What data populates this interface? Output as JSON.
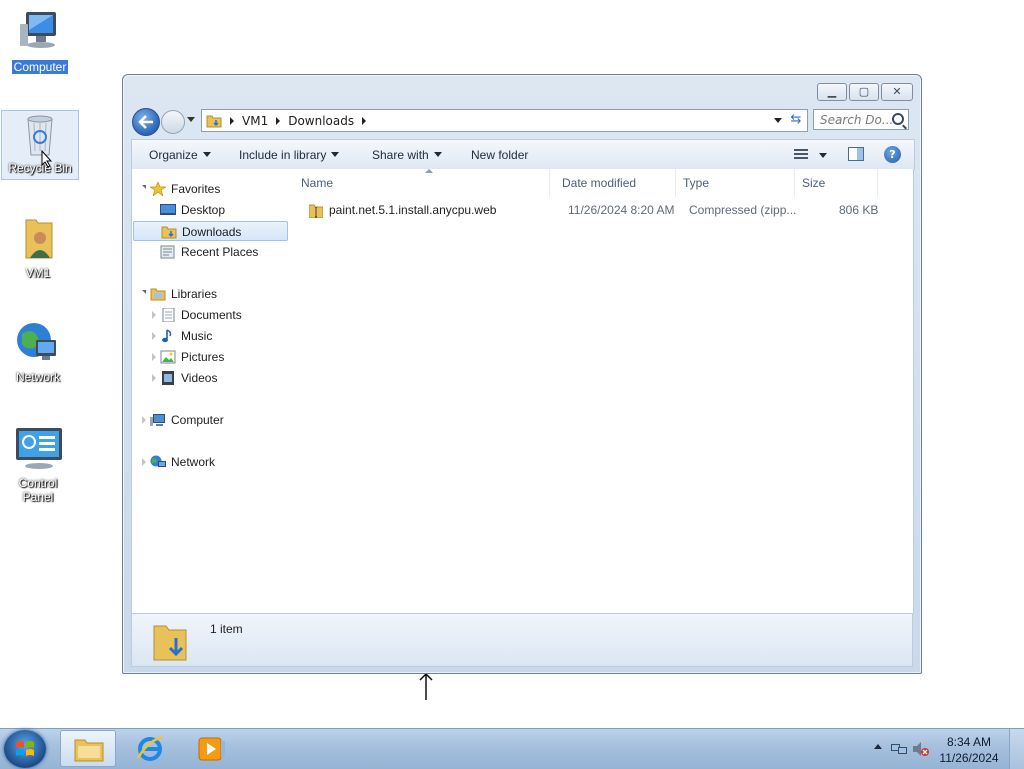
{
  "desktop": {
    "icons": [
      {
        "label": "Computer"
      },
      {
        "label": "Recycle Bin"
      },
      {
        "label": "VM1"
      },
      {
        "label": "Network"
      },
      {
        "label": "Control Panel"
      }
    ]
  },
  "window": {
    "address": {
      "crumbs": [
        "VM1",
        "Downloads"
      ]
    },
    "search": {
      "placeholder": "Search Do..."
    },
    "toolbar": {
      "organize": "Organize",
      "include_in_library": "Include in library",
      "share_with": "Share with",
      "new_folder": "New folder"
    },
    "nav_pane": {
      "favorites": "Favorites",
      "desktop": "Desktop",
      "downloads": "Downloads",
      "recent_places": "Recent Places",
      "libraries": "Libraries",
      "documents": "Documents",
      "music": "Music",
      "pictures": "Pictures",
      "videos": "Videos",
      "computer": "Computer",
      "network": "Network"
    },
    "columns": {
      "name": "Name",
      "date_modified": "Date modified",
      "type": "Type",
      "size": "Size"
    },
    "files": [
      {
        "name": "paint.net.5.1.install.anycpu.web",
        "date_modified": "11/26/2024 8:20 AM",
        "type": "Compressed (zipp...",
        "size": "806 KB"
      }
    ],
    "details": {
      "item_count": "1 item"
    }
  },
  "taskbar": {
    "clock": {
      "time": "8:34 AM",
      "date": "11/26/2024"
    }
  }
}
